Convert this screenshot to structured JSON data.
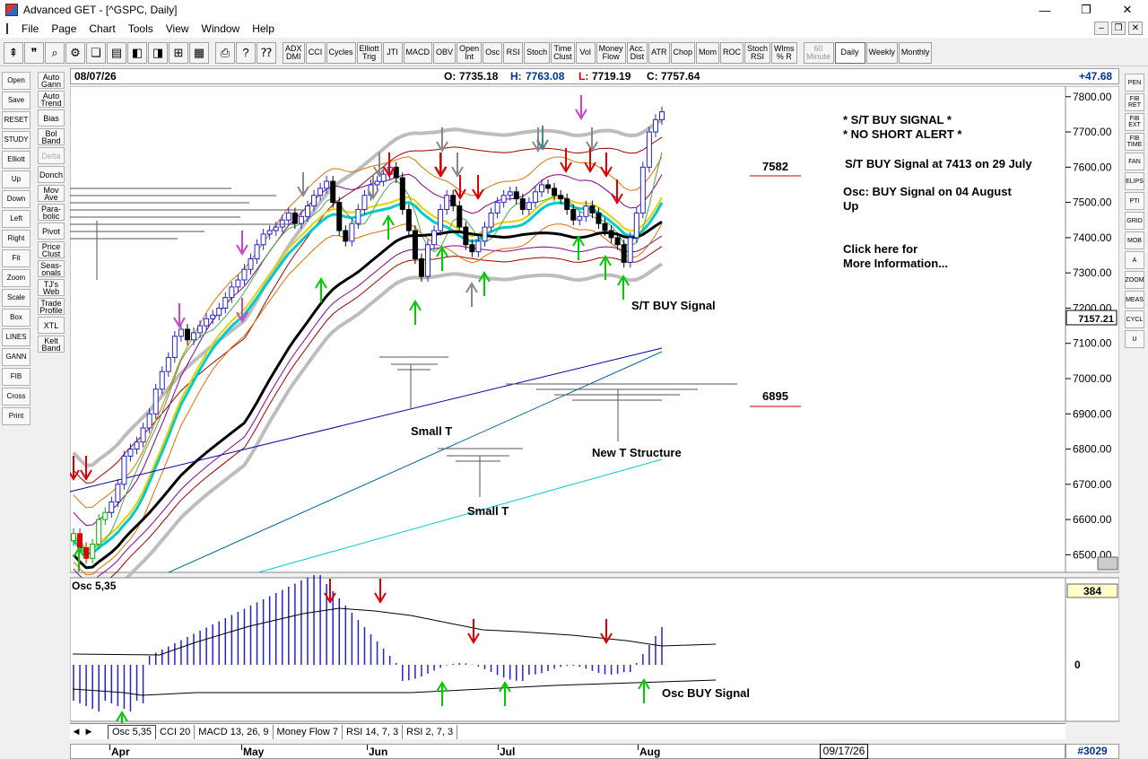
{
  "window": {
    "title": "Advanced GET - [^GSPC, Daily]",
    "controls": {
      "minimize": "—",
      "restore": "❐",
      "close": "✕"
    }
  },
  "menu": [
    "File",
    "Page",
    "Chart",
    "Tools",
    "View",
    "Window",
    "Help"
  ],
  "toolbar": {
    "studies": [
      "ADX\nDMI",
      "CCI",
      "Cycles",
      "Elliott\nTrig",
      "JTI",
      "MACD",
      "OBV",
      "Open\nInt",
      "Osc",
      "RSI",
      "Stoch",
      "Time\nClust",
      "Vol",
      "Money\nFlow",
      "Acc.\nDist",
      "ATR",
      "Chop",
      "Mom",
      "ROC",
      "Stoch\nRSI",
      "Wlms\n% R"
    ],
    "timeframes": [
      "60\nMinute",
      "Daily",
      "Weekly",
      "Monthly"
    ],
    "selected_timeframe": "Daily"
  },
  "left_tools": [
    "Open",
    "Save",
    "RESET",
    "STUDY",
    "Elliott",
    "Up",
    "Down",
    "Left",
    "Right",
    "Fit",
    "Zoom",
    "Scale",
    "Box",
    "LINES",
    "GANN",
    "FIB",
    "Cross",
    "Print"
  ],
  "study_buttons": [
    "Auto\nGann",
    "Auto\nTrend",
    "Bias",
    "Bol\nBand",
    "Delta",
    "Donch",
    "Mov\nAve",
    "Para-\nbolic",
    "Pivot",
    "Price\nClust",
    "Seas-\nonals",
    "TJ's\nWeb",
    "Trade\nProfile",
    "XTL",
    "Kelt\nBand"
  ],
  "right_tools": [
    "PEN",
    "FIB\nRET",
    "FIB\nEXT",
    "FIB\nTIME",
    "FAN",
    "ELIPS",
    "PTI",
    "GRID",
    "MOB",
    "A",
    "ZOOM",
    "MEAS",
    "CYCL",
    "U"
  ],
  "quote": {
    "date": "08/07/26",
    "open_label": "O:",
    "open": "7735.18",
    "high_label": "H:",
    "high": "7763.08",
    "low_label": "L:",
    "low": "7719.19",
    "close_label": "C:",
    "close": "7757.64",
    "change": "+47.68"
  },
  "price_axis": {
    "ticks": [
      "7800.00",
      "7700.00",
      "7600.00",
      "7500.00",
      "7400.00",
      "7300.00",
      "7200.00",
      "7100.00",
      "7000.00",
      "6900.00",
      "6800.00",
      "6700.00",
      "6600.00",
      "6500.00"
    ],
    "cursor_price": "7157.21"
  },
  "annotations": {
    "signal_1": "* S/T BUY SIGNAL *",
    "signal_2": "* NO SHORT ALERT *",
    "st_buy_detail": "S/T BUY Signal at 7413 on 29 July",
    "osc_detail_1": "Osc: BUY Signal on 04 August",
    "osc_detail_2": "Up",
    "more_info_1": "Click here for",
    "more_info_2": "More Information...",
    "level_high": "7582",
    "level_low": "6895",
    "st_buy_label": "S/T BUY Signal",
    "small_t_1": "Small T",
    "small_t_2": "Small T",
    "new_t": "New T Structure"
  },
  "oscillator": {
    "title": "Osc 5,35",
    "value": "384",
    "zero": "0",
    "buy_label": "Osc BUY Signal"
  },
  "tabs": [
    "Osc 5,35",
    "CCI 20",
    "MACD 13, 26, 9",
    "Money Flow 7",
    "RSI 14, 7, 3",
    "RSI 2, 7, 3"
  ],
  "active_tab": "Osc 5,35",
  "dates": [
    "Apr",
    "May",
    "Jun",
    "Jul",
    "Aug"
  ],
  "cursor_date": "09/17/26",
  "bar_count": "#3029",
  "chart_data": {
    "type": "candlestick",
    "y_range": [
      6450,
      7830
    ],
    "closes": [
      6560,
      6520,
      6490,
      6530,
      6600,
      6620,
      6650,
      6700,
      6780,
      6800,
      6820,
      6860,
      6900,
      6970,
      7020,
      7060,
      7120,
      7140,
      7110,
      7130,
      7150,
      7170,
      7180,
      7200,
      7230,
      7260,
      7280,
      7310,
      7340,
      7380,
      7410,
      7420,
      7430,
      7450,
      7470,
      7440,
      7460,
      7490,
      7520,
      7540,
      7560,
      7500,
      7420,
      7390,
      7440,
      7480,
      7520,
      7550,
      7560,
      7580,
      7600,
      7570,
      7480,
      7420,
      7340,
      7290,
      7380,
      7420,
      7480,
      7520,
      7490,
      7430,
      7380,
      7360,
      7390,
      7430,
      7470,
      7500,
      7520,
      7530,
      7510,
      7480,
      7500,
      7530,
      7550,
      7540,
      7520,
      7510,
      7480,
      7450,
      7460,
      7490,
      7470,
      7440,
      7420,
      7400,
      7380,
      7330,
      7400,
      7470,
      7600,
      7700,
      7735,
      7757
    ]
  }
}
